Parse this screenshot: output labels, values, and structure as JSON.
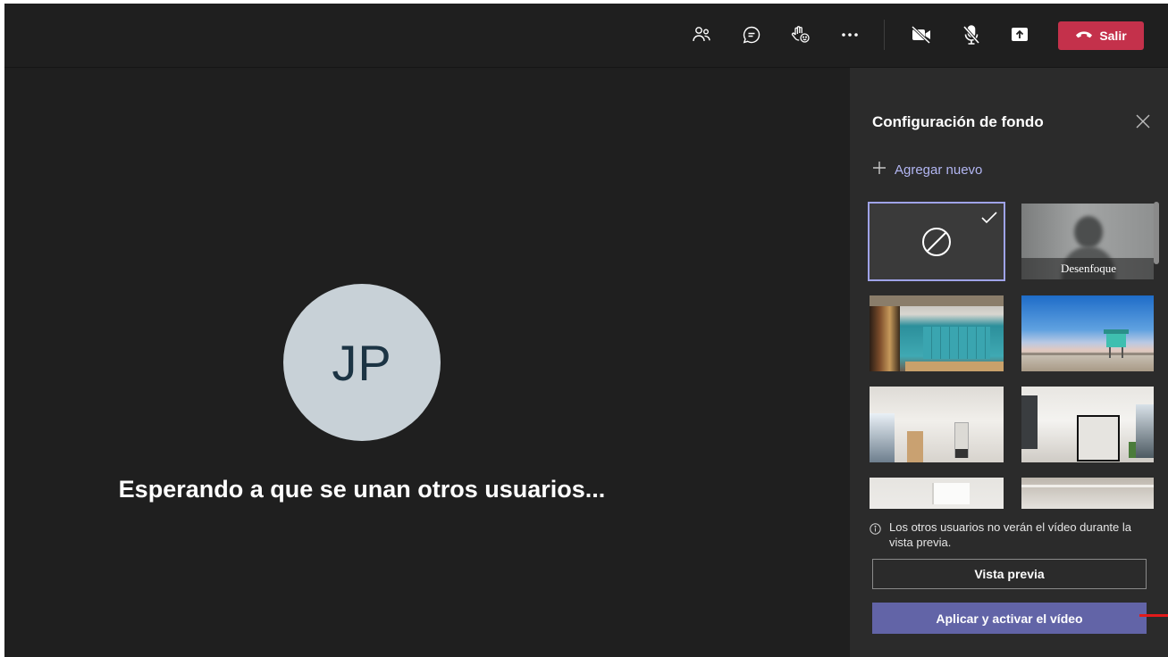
{
  "toolbar": {
    "participants_icon": "people-icon",
    "chat_icon": "chat-icon",
    "reactions_icon": "raise-hand-icon",
    "more_icon": "more-icon",
    "camera_icon": "camera-off-icon",
    "mic_icon": "mic-off-icon",
    "share_icon": "share-screen-icon",
    "leave_label": "Salir",
    "leave_color": "#c4314b"
  },
  "stage": {
    "avatar_initials": "JP",
    "avatar_color": "#c8d1d7",
    "waiting_text": "Esperando a que se unan otros usuarios..."
  },
  "panel": {
    "title": "Configuración de fondo",
    "add_new_label": "Agregar nuevo",
    "backgrounds": [
      {
        "kind": "none",
        "selected": true
      },
      {
        "kind": "blur",
        "label": "Desenfoque"
      },
      {
        "kind": "image",
        "scene": "office-lockers"
      },
      {
        "kind": "image",
        "scene": "beach-lifeguard-tower"
      },
      {
        "kind": "image",
        "scene": "white-room"
      },
      {
        "kind": "image",
        "scene": "white-room-window"
      },
      {
        "kind": "image",
        "scene": "bright-room"
      },
      {
        "kind": "image",
        "scene": "grey-room"
      }
    ],
    "notice": "Los otros usuarios no verán el vídeo durante la vista previa.",
    "preview_label": "Vista previa",
    "apply_label": "Aplicar y activar el vídeo",
    "accent_color": "#6264a7"
  }
}
